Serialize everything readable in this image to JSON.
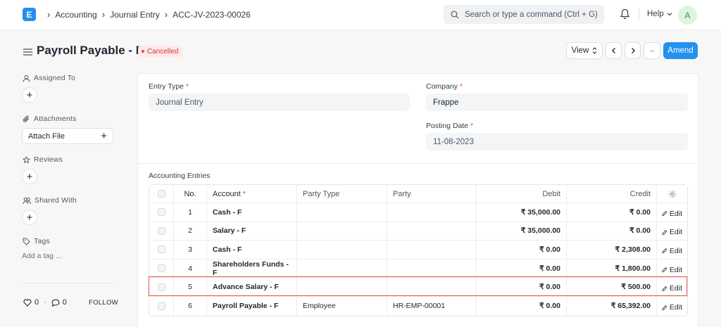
{
  "navbar": {
    "logo_letter": "E",
    "breadcrumbs": [
      "Accounting",
      "Journal Entry",
      "ACC-JV-2023-00026"
    ],
    "search_placeholder": "Search or type a command (Ctrl + G)",
    "help_label": "Help",
    "avatar_initial": "A"
  },
  "page": {
    "title": "Payroll Payable - F",
    "status": "Cancelled",
    "view_label": "View",
    "more_label": "···",
    "amend_label": "Amend"
  },
  "sidebar": {
    "assigned_to": "Assigned To",
    "attachments": "Attachments",
    "attach_file": "Attach File",
    "reviews": "Reviews",
    "shared_with": "Shared With",
    "tags": "Tags",
    "add_tag": "Add a tag ...",
    "likes_count": "0",
    "comments_count": "0",
    "separator": "·",
    "follow": "FOLLOW"
  },
  "form": {
    "entry_type_label": "Entry Type",
    "entry_type_value": "Journal Entry",
    "company_label": "Company",
    "company_value": "Frappe",
    "posting_date_label": "Posting Date",
    "posting_date_value": "11-08-2023",
    "required_mark": "*",
    "table_title": "Accounting Entries"
  },
  "table": {
    "headers": {
      "no": "No.",
      "account": "Account",
      "party_type": "Party Type",
      "party": "Party",
      "debit": "Debit",
      "credit": "Credit"
    },
    "edit_label": "Edit",
    "rows": [
      {
        "no": "1",
        "account": "Cash - F",
        "party_type": "",
        "party": "",
        "debit": "₹ 35,000.00",
        "credit": "₹ 0.00"
      },
      {
        "no": "2",
        "account": "Salary - F",
        "party_type": "",
        "party": "",
        "debit": "₹ 35,000.00",
        "credit": "₹ 0.00"
      },
      {
        "no": "3",
        "account": "Cash - F",
        "party_type": "",
        "party": "",
        "debit": "₹ 0.00",
        "credit": "₹ 2,308.00"
      },
      {
        "no": "4",
        "account": "Shareholders Funds - F",
        "party_type": "",
        "party": "",
        "debit": "₹ 0.00",
        "credit": "₹ 1,800.00"
      },
      {
        "no": "5",
        "account": "Advance Salary - F",
        "party_type": "",
        "party": "",
        "debit": "₹ 0.00",
        "credit": "₹ 500.00"
      },
      {
        "no": "6",
        "account": "Payroll Payable - F",
        "party_type": "Employee",
        "party": "HR-EMP-00001",
        "debit": "₹ 0.00",
        "credit": "₹ 65,392.00"
      }
    ]
  },
  "colors": {
    "primary": "#2490ef",
    "cancelled_text": "#d23c3c",
    "cancelled_bg": "#fde8e8",
    "highlight_border": "#e8573f"
  }
}
